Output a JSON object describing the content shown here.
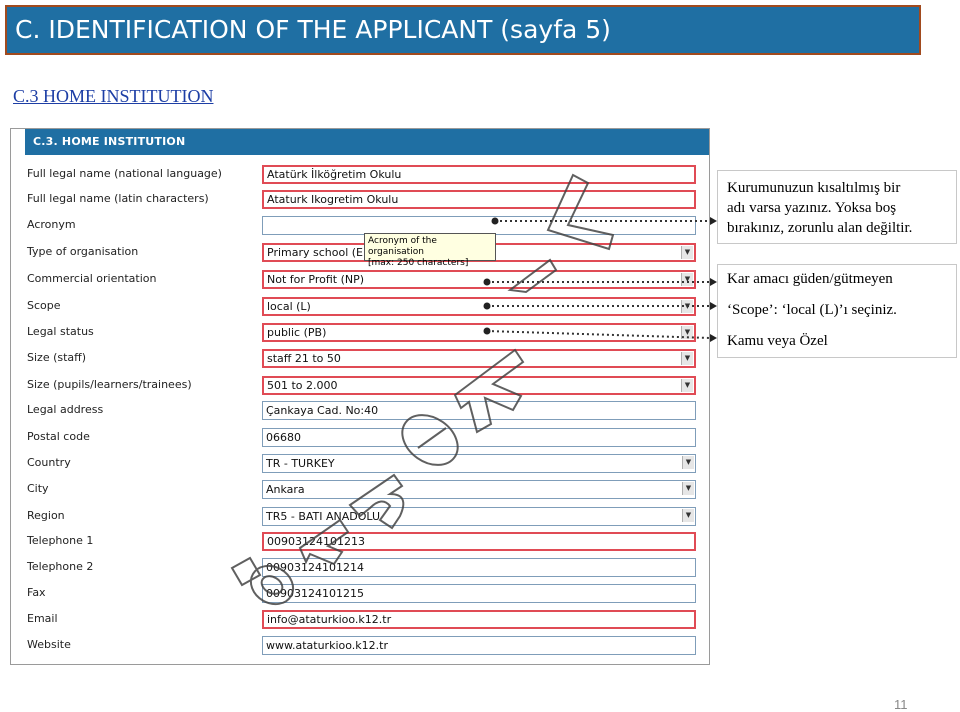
{
  "slide": {
    "title": "C. IDENTIFICATION OF THE APPLICANT (sayfa 5)",
    "subtitle": "C.3 HOME INSTITUTION",
    "page_number": "11",
    "watermark": "örnek"
  },
  "form": {
    "header": "C.3. HOME INSTITUTION",
    "rows": [
      {
        "label": "Full legal name (national language)",
        "value": "Atatürk İlköğretim Okulu",
        "required": true,
        "dropdown": false
      },
      {
        "label": "Full legal name (latin characters)",
        "value": "Ataturk Ikogretim Okulu",
        "required": true,
        "dropdown": false
      },
      {
        "label": "Acronym",
        "value": "",
        "required": false,
        "dropdown": false
      },
      {
        "label": "Type of organisation",
        "value": "Primary school (ED",
        "required": true,
        "dropdown": true
      },
      {
        "label": "Commercial orientation",
        "value": "Not for Profit (NP)",
        "required": true,
        "dropdown": true
      },
      {
        "label": "Scope",
        "value": "local (L)",
        "required": true,
        "dropdown": true
      },
      {
        "label": "Legal status",
        "value": "public (PB)",
        "required": true,
        "dropdown": true
      },
      {
        "label": "Size (staff)",
        "value": "staff 21 to 50",
        "required": true,
        "dropdown": true
      },
      {
        "label": "Size (pupils/learners/trainees)",
        "value": "501 to 2.000",
        "required": true,
        "dropdown": true
      },
      {
        "label": "Legal address",
        "value": "Çankaya Cad. No:40",
        "required": false,
        "dropdown": false
      },
      {
        "label": "Postal code",
        "value": "06680",
        "required": false,
        "dropdown": false
      },
      {
        "label": "Country",
        "value": "TR - TURKEY",
        "required": false,
        "dropdown": true
      },
      {
        "label": "City",
        "value": "Ankara",
        "required": false,
        "dropdown": true
      },
      {
        "label": "Region",
        "value": "TR5 - BATI ANADOLU",
        "required": false,
        "dropdown": true
      },
      {
        "label": "Telephone 1",
        "value": "00903124101213",
        "required": true,
        "dropdown": false
      },
      {
        "label": "Telephone 2",
        "value": "00903124101214",
        "required": false,
        "dropdown": false
      },
      {
        "label": "Fax",
        "value": "00903124101215",
        "required": false,
        "dropdown": false
      },
      {
        "label": "Email",
        "value": "info@ataturkioo.k12.tr",
        "required": true,
        "dropdown": false
      },
      {
        "label": "Website",
        "value": "www.ataturkioo.k12.tr",
        "required": false,
        "dropdown": false
      }
    ],
    "tooltip": {
      "line1": "Acronym of the organisation",
      "line2": "[max: 250 characters]"
    }
  },
  "notes": {
    "acronym": [
      "Kurumunuzun kısaltılmış bir",
      "adı varsa yazınız. Yoksa boş",
      "bırakınız, zorunlu alan değiltir."
    ],
    "commercial": "Kar amacı güden/gütmeyen",
    "scope": "‘Scope’: ‘local (L)’ı seçiniz.",
    "legal_status": "Kamu veya Özel"
  },
  "colors": {
    "title_bg": "#1f6fa3",
    "title_border": "#a14a1e",
    "required_border": "#e04b55",
    "watermark": "#444444"
  }
}
